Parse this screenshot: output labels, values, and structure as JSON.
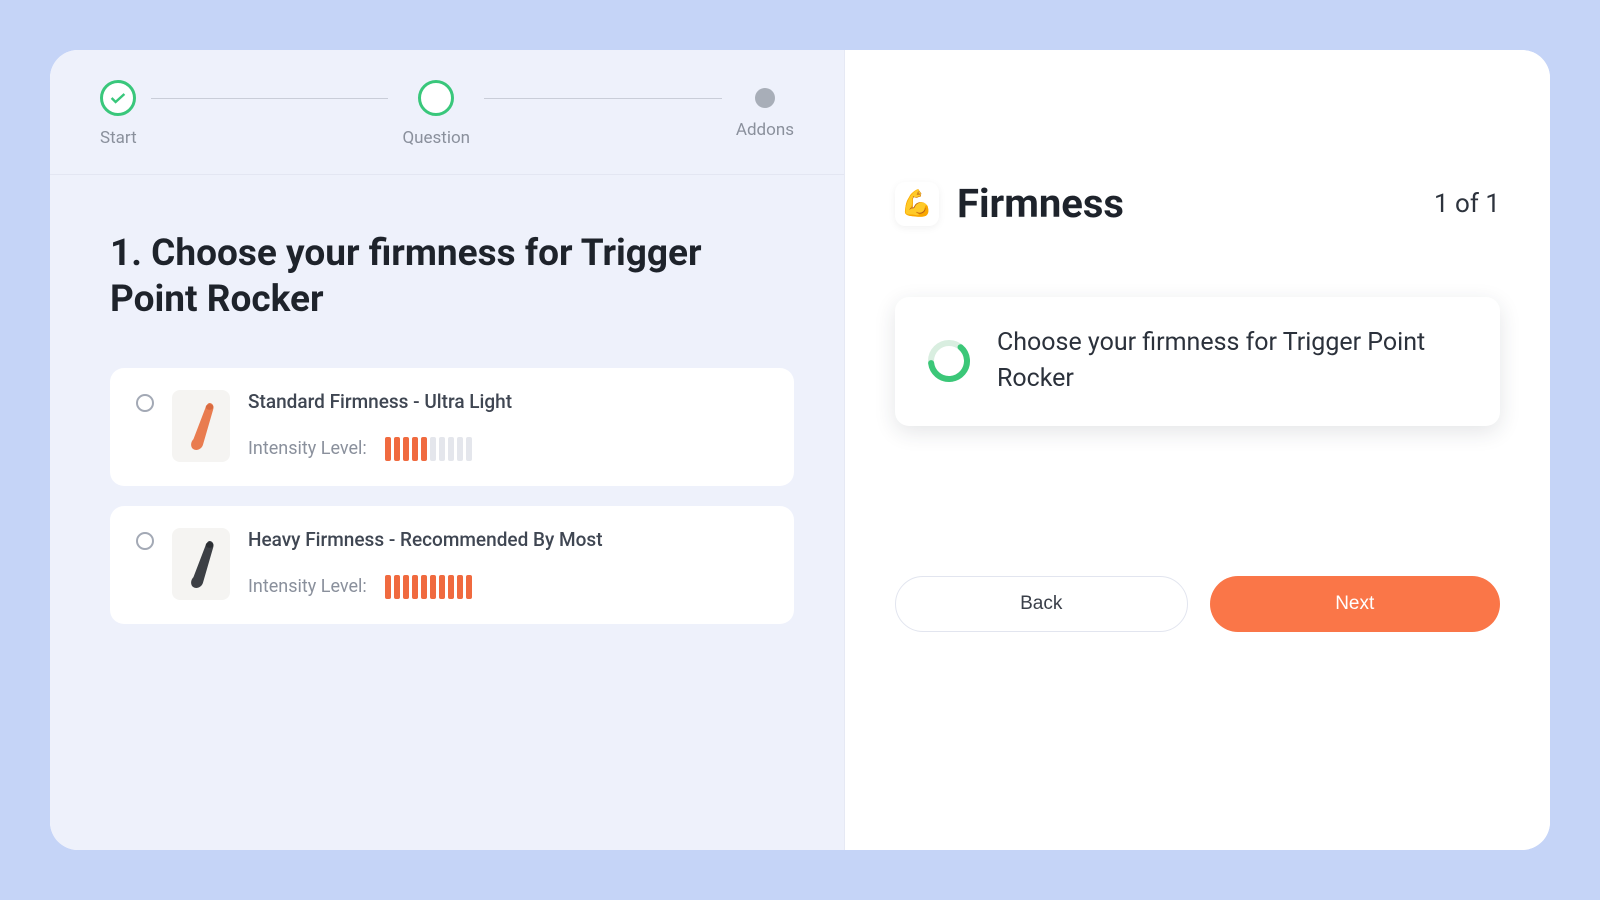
{
  "stepper": {
    "steps": [
      {
        "label": "Start",
        "state": "done"
      },
      {
        "label": "Question",
        "state": "active"
      },
      {
        "label": "Addons",
        "state": "pending"
      }
    ]
  },
  "question": {
    "number": "1",
    "heading": "1. Choose your firmness for Trigger Point Rocker",
    "intensity_label": "Intensity Level:",
    "options": [
      {
        "title": "Standard Firmness - Ultra Light",
        "intensity_on": 5,
        "intensity_total": 10,
        "color": "#e97c50"
      },
      {
        "title": "Heavy Firmness - Recommended By Most",
        "intensity_on": 10,
        "intensity_total": 10,
        "color": "#3c3f45"
      }
    ]
  },
  "summary": {
    "emoji": "💪",
    "title": "Firmness",
    "counter": "1 of 1",
    "card_text": "Choose your firmness for Trigger Point Rocker"
  },
  "actions": {
    "back": "Back",
    "next": "Next"
  },
  "colors": {
    "accent_green": "#39c77b",
    "accent_orange": "#fa7648",
    "bar_on": "#f06a3f"
  }
}
